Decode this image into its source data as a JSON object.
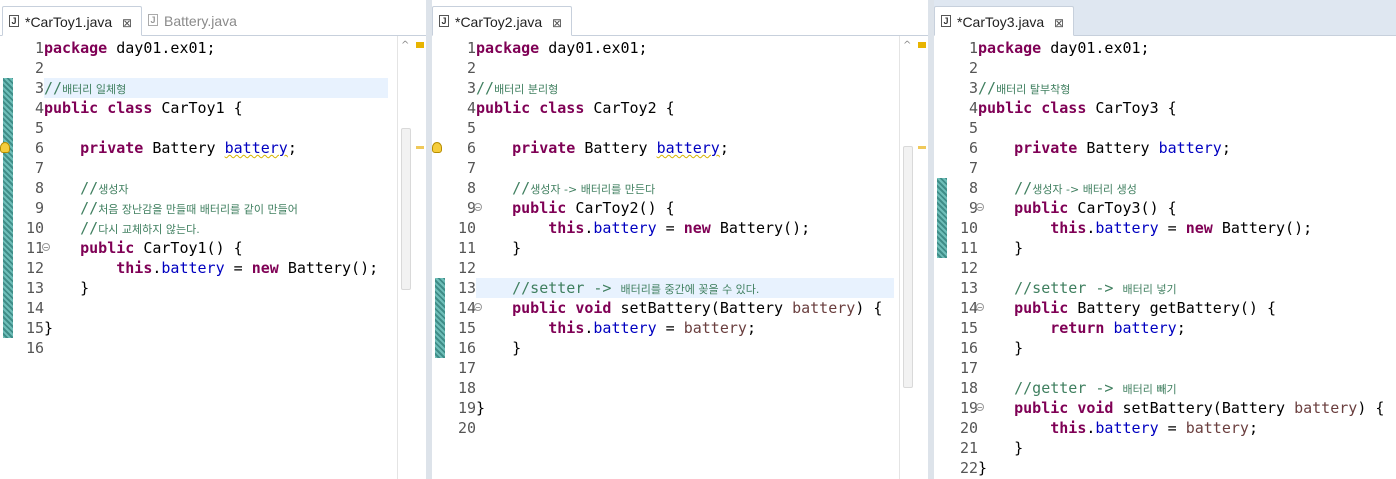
{
  "colors": {
    "keyword": "#7f0055",
    "field": "#0000c0",
    "comment": "#3f7f5f",
    "highlight": "#e8f2fe",
    "quickdiff": "#5aa4a1"
  },
  "pane1": {
    "tabs": {
      "active_label": "*CarToy1.java",
      "inactive_label": "Battery.java",
      "close_glyph": "⊠"
    },
    "lines": [
      "1",
      "2",
      "3",
      "4",
      "5",
      "6",
      "7",
      "8",
      "9",
      "10",
      "11",
      "12",
      "13",
      "14",
      "15",
      "16"
    ],
    "code": {
      "l1_kw": "package",
      "l1_rest": " day01.ex01;",
      "l3_cm": "//",
      "l3_ko": "배터리 일체형",
      "l4_kw": "public class",
      "l4_rest": " CarToy1 {",
      "l6_kw": "private",
      "l6_type": " Battery ",
      "l6_fld": "battery",
      "l6_end": ";",
      "l8_cm": "//",
      "l8_ko": "생성자",
      "l9_cm": "//",
      "l9_ko": "처음 장난감을 만들때 배터리를 같이 만들어",
      "l10_cm": "//",
      "l10_ko": "다시 교체하지 않는다.",
      "l11_kw": "public",
      "l11_rest": " CarToy1() {",
      "l12_kw": "this",
      "l12_dot": ".",
      "l12_fld": "battery",
      "l12_eq": " = ",
      "l12_kw2": "new",
      "l12_rest": " Battery();",
      "l13": "}",
      "l15": "}"
    }
  },
  "pane2": {
    "tabs": {
      "active_label": "*CarToy2.java",
      "close_glyph": "⊠"
    },
    "lines": [
      "1",
      "2",
      "3",
      "4",
      "5",
      "6",
      "7",
      "8",
      "9",
      "10",
      "11",
      "12",
      "13",
      "14",
      "15",
      "16",
      "17",
      "18",
      "19",
      "20"
    ],
    "code": {
      "l1_kw": "package",
      "l1_rest": " day01.ex01;",
      "l3_cm": "//",
      "l3_ko": "배터리 분리형",
      "l4_kw": "public class",
      "l4_rest": " CarToy2 {",
      "l6_kw": "private",
      "l6_type": " Battery ",
      "l6_fld": "battery",
      "l6_end": ";",
      "l8_cm": "//",
      "l8_ko": "생성자 -> 배터리를 만든다",
      "l9_kw": "public",
      "l9_rest": " CarToy2() {",
      "l10_kw": "this",
      "l10_dot": ".",
      "l10_fld": "battery",
      "l10_eq": " = ",
      "l10_kw2": "new",
      "l10_rest": " Battery();",
      "l11": "}",
      "l13_cm": "//setter -> ",
      "l13_ko": "배터리를 중간에 꽂을 수 있다.",
      "l14_kw": "public void",
      "l14_a": " setBattery(Battery ",
      "l14_prm": "battery",
      "l14_b": ") {",
      "l15_kw": "this",
      "l15_dot": ".",
      "l15_fld": "battery",
      "l15_eq": " = ",
      "l15_prm": "battery",
      "l15_end": ";",
      "l16": "}",
      "l19": "}"
    }
  },
  "pane3": {
    "tabs": {
      "active_label": "*CarToy3.java",
      "close_glyph": "⊠"
    },
    "lines": [
      "1",
      "2",
      "3",
      "4",
      "5",
      "6",
      "7",
      "8",
      "9",
      "10",
      "11",
      "12",
      "13",
      "14",
      "15",
      "16",
      "17",
      "18",
      "19",
      "20",
      "21",
      "22"
    ],
    "code": {
      "l1_kw": "package",
      "l1_rest": " day01.ex01;",
      "l3_cm": "//",
      "l3_ko": "배터리 탈부착형",
      "l4_kw": "public class",
      "l4_rest": " CarToy3 {",
      "l6_kw": "private",
      "l6_type": " Battery ",
      "l6_fld": "battery",
      "l6_end": ";",
      "l8_cm": "//",
      "l8_ko": "생성자 -> 배터리 생성",
      "l9_kw": "public",
      "l9_rest": " CarToy3() {",
      "l10_kw": "this",
      "l10_dot": ".",
      "l10_fld": "battery",
      "l10_eq": " = ",
      "l10_kw2": "new",
      "l10_rest": " Battery();",
      "l11": "}",
      "l13_cm": "//setter -> ",
      "l13_ko": "배터리 넣기",
      "l14_kw": "public",
      "l14_rest": " Battery getBattery() {",
      "l15_kw": "return",
      "l15_sp": " ",
      "l15_fld": "battery",
      "l15_end": ";",
      "l16": "}",
      "l18_cm": "//getter -> ",
      "l18_ko": "배터리 빼기",
      "l19_kw": "public void",
      "l19_a": " setBattery(Battery ",
      "l19_prm": "battery",
      "l19_b": ") {",
      "l20_kw": "this",
      "l20_dot": ".",
      "l20_fld": "battery",
      "l20_eq": " = ",
      "l20_prm": "battery",
      "l20_end": ";",
      "l21": "}",
      "l22": "}"
    }
  }
}
